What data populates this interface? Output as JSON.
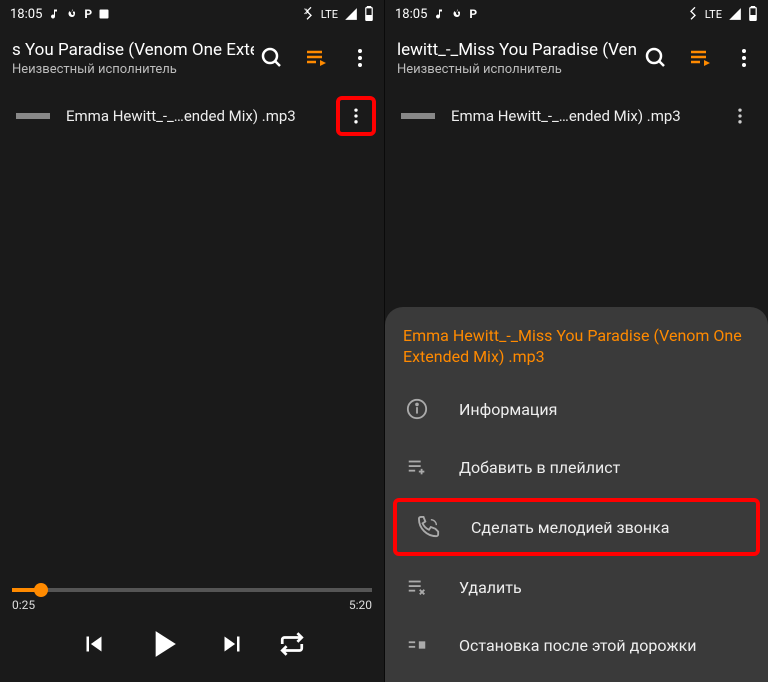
{
  "status": {
    "time": "18:05",
    "network": "LTE"
  },
  "left": {
    "title": "s You Paradise (Venom One Exten",
    "subtitle": "Неизвестный исполнитель",
    "track": "Emma Hewitt_-_…ended Mix) .mp3",
    "currentTime": "0:25",
    "duration": "5:20"
  },
  "right": {
    "title": "lewitt_-_Miss You Paradise (Ven",
    "subtitle": "Неизвестный исполнитель",
    "track": "Emma Hewitt_-_…ended Mix) .mp3",
    "sheetTitle": "Emma Hewitt_-_Miss You Paradise (Venom One Extended Mix) .mp3",
    "menu": {
      "info": "Информация",
      "addPlaylist": "Добавить в плейлист",
      "ringtone": "Сделать мелодией звонка",
      "delete": "Удалить",
      "stopAfter": "Остановка после этой дорожки"
    }
  }
}
